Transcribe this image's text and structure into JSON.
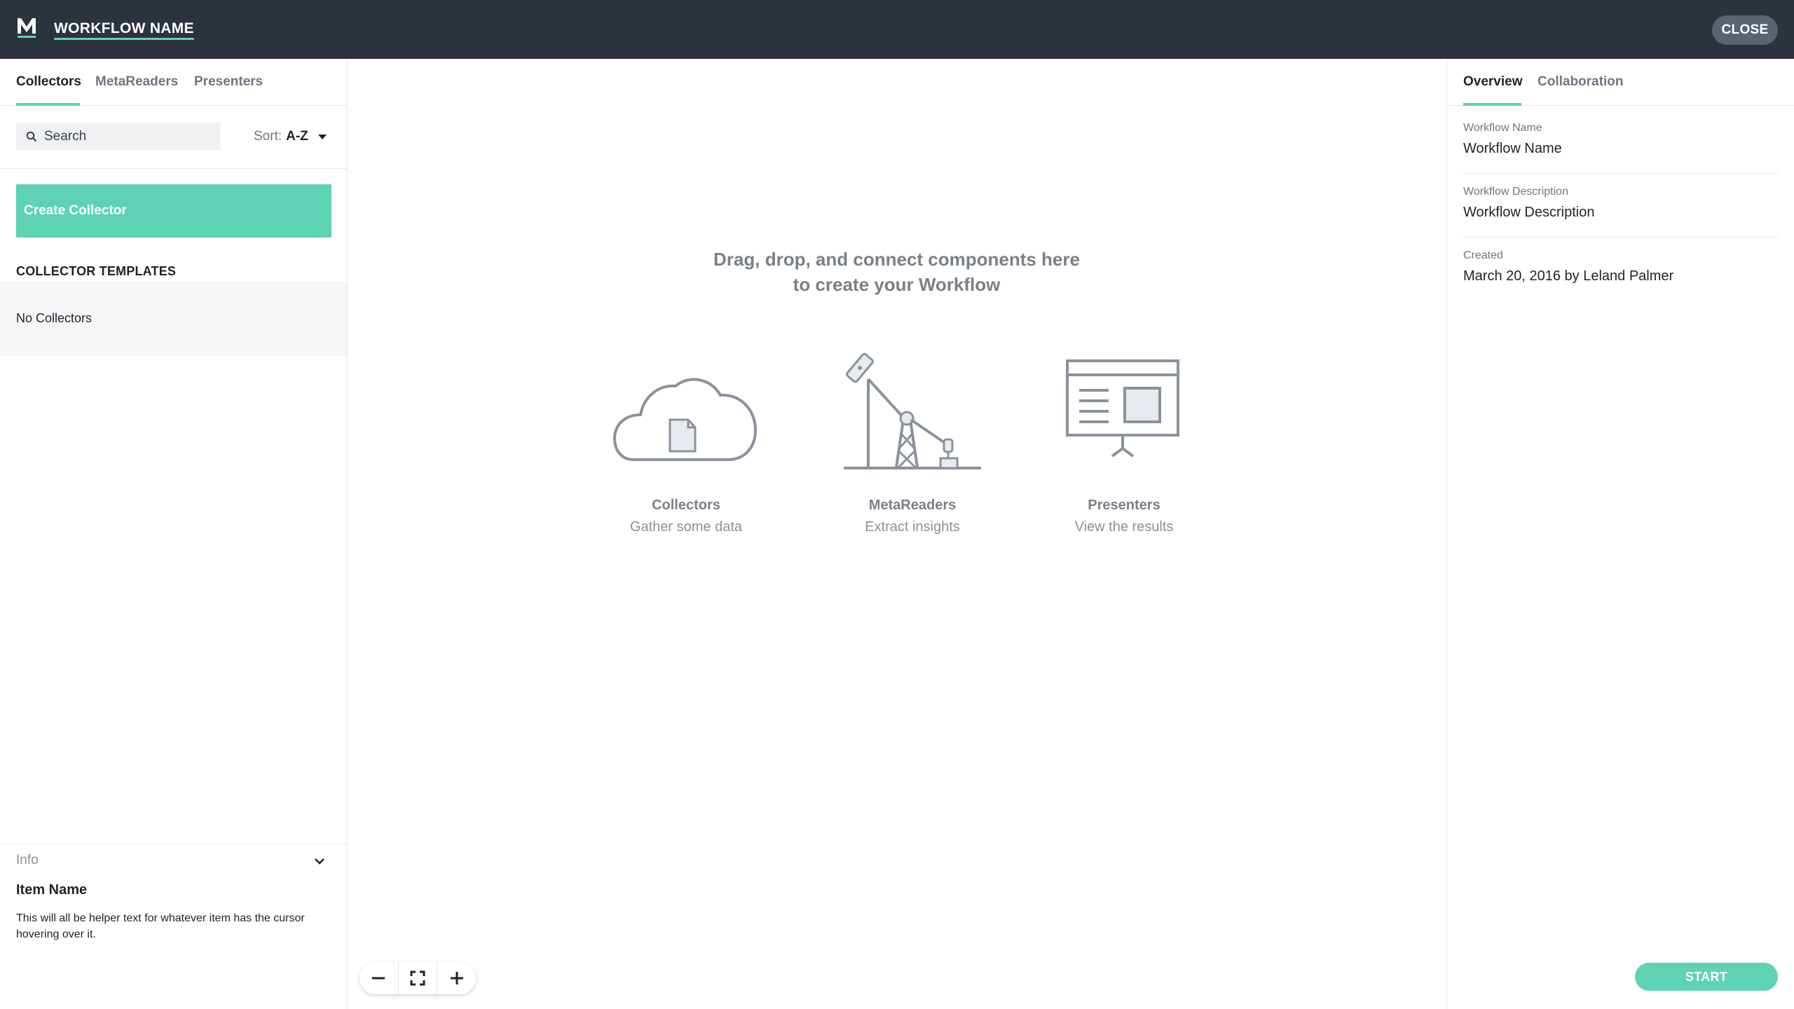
{
  "header": {
    "logo_letter": "M",
    "workflow_title": "WORKFLOW NAME",
    "close_label": "CLOSE",
    "brand_color": "#5dd3b3",
    "bar_color": "#2b333d"
  },
  "left_panel": {
    "tabs": [
      {
        "label": "Collectors",
        "active": true
      },
      {
        "label": "MetaReaders",
        "active": false
      },
      {
        "label": "Presenters",
        "active": false
      }
    ],
    "search": {
      "placeholder": "Search",
      "icon": "search-icon"
    },
    "sort": {
      "label": "Sort:",
      "value": "A-Z"
    },
    "create_label": "Create Collector",
    "templates_heading": "COLLECTOR TEMPLATES",
    "templates_empty": "No Collectors",
    "info": {
      "label": "Info",
      "item_name": "Item Name",
      "helper_text": "This will all be helper text for whatever item has the cursor hovering over it."
    }
  },
  "canvas": {
    "hint_line1": "Drag, drop, and connect components here",
    "hint_line2": "to create your Workflow",
    "components": [
      {
        "name": "Collectors",
        "description": "Gather some data",
        "icon": "cloud-document-icon"
      },
      {
        "name": "MetaReaders",
        "description": "Extract insights",
        "icon": "oil-pump-icon"
      },
      {
        "name": "Presenters",
        "description": "View the results",
        "icon": "presentation-board-icon"
      }
    ],
    "zoom_controls": [
      "zoom-out-icon",
      "fit-screen-icon",
      "zoom-in-icon"
    ]
  },
  "right_panel": {
    "tabs": [
      {
        "label": "Overview",
        "active": true
      },
      {
        "label": "Collaboration",
        "active": false
      }
    ],
    "fields": [
      {
        "label": "Workflow Name",
        "value": "Workflow Name"
      },
      {
        "label": "Workflow Description",
        "value": "Workflow Description"
      },
      {
        "label": "Created",
        "value": "March 20, 2016 by Leland Palmer"
      }
    ],
    "start_label": "START"
  }
}
